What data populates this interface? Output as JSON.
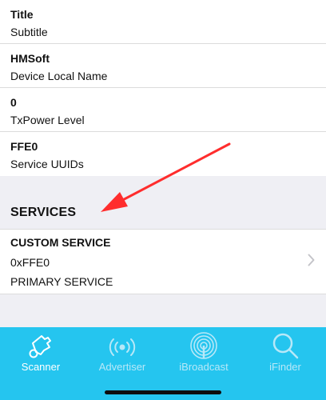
{
  "properties": [
    {
      "value": "Title",
      "label": "Subtitle"
    },
    {
      "value": "HMSoft",
      "label": "Device Local Name"
    },
    {
      "value": "0",
      "label": "TxPower Level"
    },
    {
      "value": "FFE0",
      "label": "Service UUIDs"
    }
  ],
  "services_header": "SERVICES",
  "service": {
    "name": "CUSTOM SERVICE",
    "uuid": "0xFFE0",
    "type": "PRIMARY SERVICE"
  },
  "tabs": [
    {
      "label": "Scanner",
      "icon": "scanner-icon",
      "active": true
    },
    {
      "label": "Advertiser",
      "icon": "broadcast-signal-icon",
      "active": false
    },
    {
      "label": "iBroadcast",
      "icon": "ibroadcast-icon",
      "active": false
    },
    {
      "label": "iFinder",
      "icon": "magnifier-icon",
      "active": false
    }
  ],
  "colors": {
    "tabbar": "#25c5ef",
    "arrow": "#ff2d2d",
    "background": "#efeff4"
  }
}
